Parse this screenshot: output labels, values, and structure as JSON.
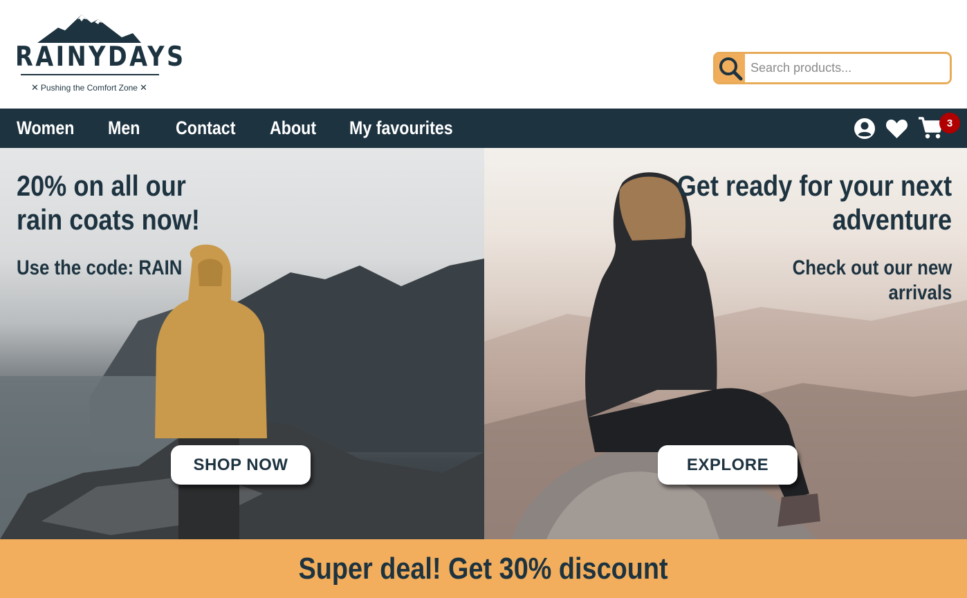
{
  "brand": {
    "name": "RAINYDAYS",
    "tagline": "Pushing the Comfort Zone",
    "tag_mark": "✕"
  },
  "search": {
    "placeholder": "Search products..."
  },
  "nav": {
    "items": [
      {
        "label": "Women"
      },
      {
        "label": "Men"
      },
      {
        "label": "Contact"
      },
      {
        "label": "About"
      },
      {
        "label": "My favourites"
      }
    ],
    "icons": [
      "account-icon",
      "heart-icon",
      "cart-icon"
    ],
    "cart_count": "3"
  },
  "hero_left": {
    "title_line1": "20% on all our",
    "title_line2": "rain coats now!",
    "subtitle": "Use the code: RAIN",
    "button": "SHOP NOW"
  },
  "hero_right": {
    "title_line1": "Get ready for your next",
    "title_line2": "adventure",
    "subtitle_line1": "Check out our new",
    "subtitle_line2": "arrivals",
    "button": "EXPLORE"
  },
  "banner": {
    "text": "Super deal! Get 30% discount"
  },
  "colors": {
    "navy": "#1d3340",
    "accent": "#f2ae5c",
    "badge": "#b00000"
  }
}
